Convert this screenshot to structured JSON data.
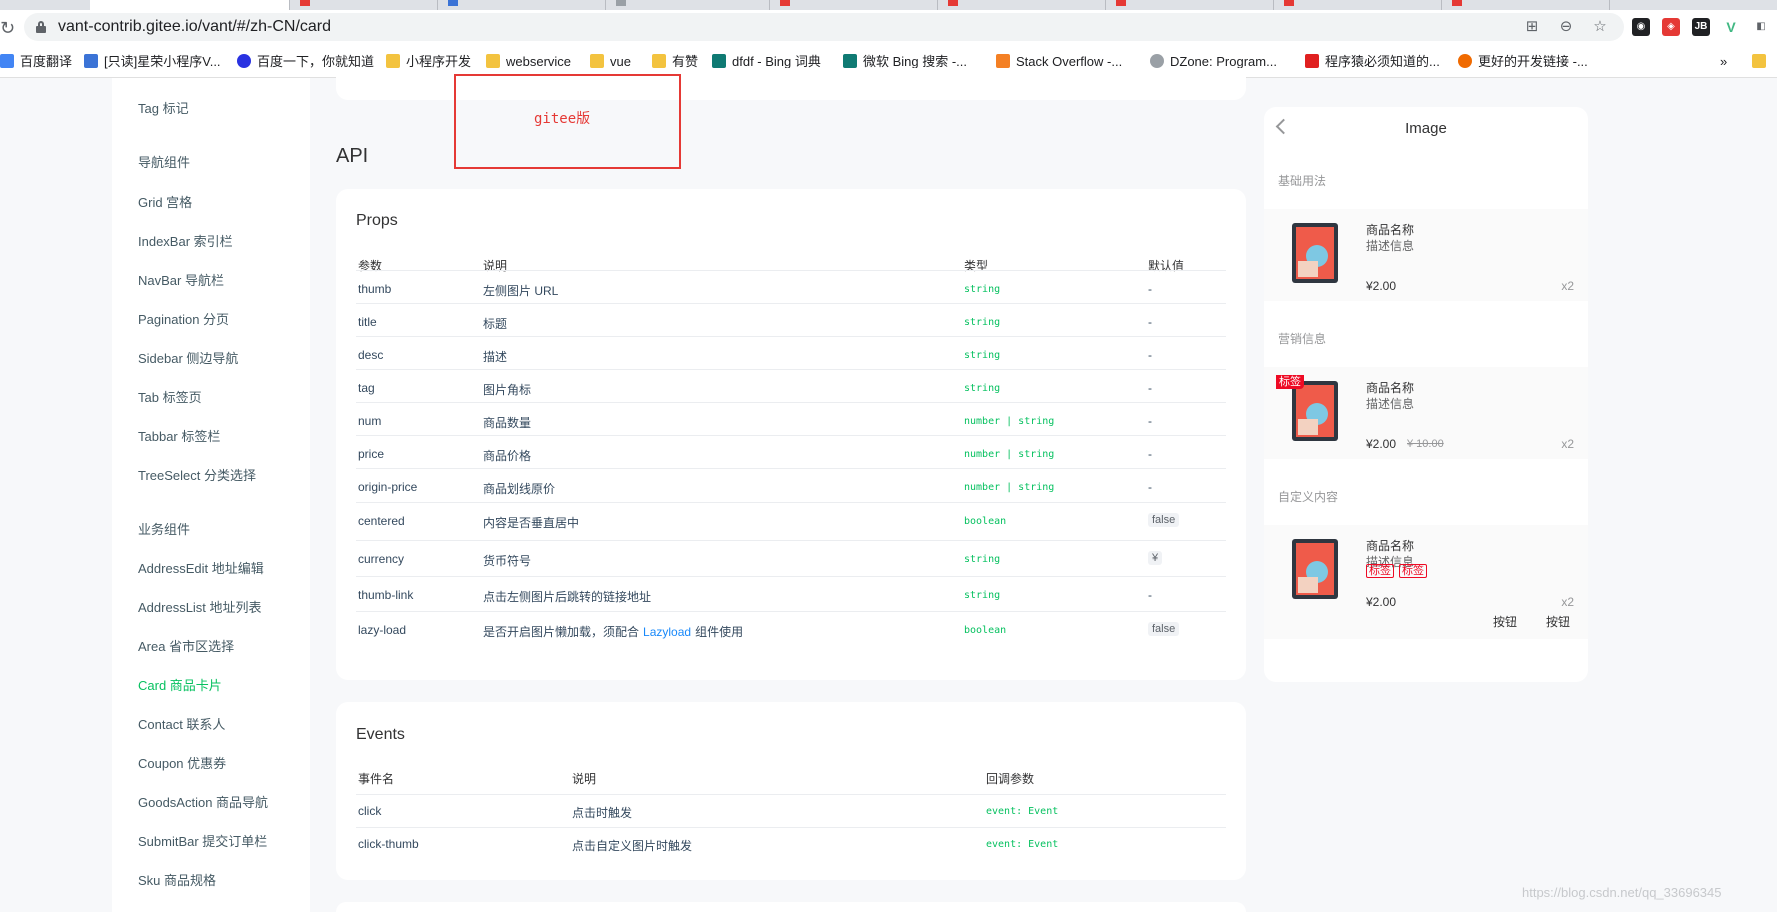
{
  "browser": {
    "url": "vant-contrib.gitee.io/vant/#/zh-CN/card"
  },
  "bookmarks": [
    {
      "label": "百度翻译",
      "icon": "translate-icon",
      "color": "#4285f4"
    },
    {
      "label": "[只读]星荣小程序V...",
      "icon": "layers-icon",
      "color": "#3b73d6"
    },
    {
      "label": "百度一下，你就知道",
      "icon": "baidu-paw-icon",
      "color": "#2932e1"
    },
    {
      "label": "小程序开发",
      "icon": "folder-icon",
      "color": "#f3c33f"
    },
    {
      "label": "webservice",
      "icon": "folder-icon",
      "color": "#f3c33f"
    },
    {
      "label": "vue",
      "icon": "folder-icon",
      "color": "#f3c33f"
    },
    {
      "label": "有赞",
      "icon": "folder-icon",
      "color": "#f3c33f"
    },
    {
      "label": "dfdf - Bing 词典",
      "icon": "bing-icon",
      "color": "#0f7a73"
    },
    {
      "label": "微软 Bing 搜索 -...",
      "icon": "bing-icon",
      "color": "#0f7a73"
    },
    {
      "label": "Stack Overflow -...",
      "icon": "stackoverflow-icon",
      "color": "#f48024"
    },
    {
      "label": "DZone: Program...",
      "icon": "dzone-icon",
      "color": "#9aa0a6"
    },
    {
      "label": "程序猿必须知道的...",
      "icon": "csdn-icon",
      "color": "#e02020"
    },
    {
      "label": "更好的开发链接 -...",
      "icon": "b-circle-icon",
      "color": "#f06a00"
    }
  ],
  "bookmarks_more": "»",
  "sidebar": {
    "items": [
      {
        "label": "Tag 标记"
      },
      {
        "label": "导航组件",
        "group": true
      },
      {
        "label": "Grid 宫格"
      },
      {
        "label": "IndexBar 索引栏"
      },
      {
        "label": "NavBar 导航栏"
      },
      {
        "label": "Pagination 分页"
      },
      {
        "label": "Sidebar 侧边导航"
      },
      {
        "label": "Tab 标签页"
      },
      {
        "label": "Tabbar 标签栏"
      },
      {
        "label": "TreeSelect 分类选择"
      },
      {
        "label": "业务组件",
        "group": true
      },
      {
        "label": "AddressEdit 地址编辑"
      },
      {
        "label": "AddressList 地址列表"
      },
      {
        "label": "Area 省市区选择"
      },
      {
        "label": "Card 商品卡片",
        "active": true
      },
      {
        "label": "Contact 联系人"
      },
      {
        "label": "Coupon 优惠券"
      },
      {
        "label": "GoodsAction 商品导航"
      },
      {
        "label": "SubmitBar 提交订单栏"
      },
      {
        "label": "Sku 商品规格"
      }
    ]
  },
  "annotation": {
    "text": "gitee版",
    "color": "#e53935"
  },
  "main": {
    "api_title": "API",
    "props": {
      "title": "Props",
      "headers": [
        "参数",
        "说明",
        "类型",
        "默认值"
      ],
      "rows": [
        {
          "param": "thumb",
          "desc": "左侧图片 URL",
          "type": "string",
          "default": "-"
        },
        {
          "param": "title",
          "desc": "标题",
          "type": "string",
          "default": "-"
        },
        {
          "param": "desc",
          "desc": "描述",
          "type": "string",
          "default": "-"
        },
        {
          "param": "tag",
          "desc": "图片角标",
          "type": "string",
          "default": "-"
        },
        {
          "param": "num",
          "desc": "商品数量",
          "type": "number | string",
          "default": "-"
        },
        {
          "param": "price",
          "desc": "商品价格",
          "type": "number | string",
          "default": "-"
        },
        {
          "param": "origin-price",
          "desc": "商品划线原价",
          "type": "number | string",
          "default": "-"
        },
        {
          "param": "centered",
          "desc": "内容是否垂直居中",
          "type": "boolean",
          "default": "false",
          "code": true
        },
        {
          "param": "currency",
          "desc": "货币符号",
          "type": "string",
          "default": "¥",
          "code": true
        },
        {
          "param": "thumb-link",
          "desc": "点击左侧图片后跳转的链接地址",
          "type": "string",
          "default": "-"
        },
        {
          "param": "lazy-load",
          "desc": "是否开启图片懒加载，须配合",
          "desc_link": "Lazyload",
          "desc_after": "组件使用",
          "type": "boolean",
          "default": "false",
          "code": true
        }
      ]
    },
    "events": {
      "title": "Events",
      "headers": [
        "事件名",
        "说明",
        "回调参数"
      ],
      "rows": [
        {
          "name": "click",
          "desc": "点击时触发",
          "args": "event: Event"
        },
        {
          "name": "click-thumb",
          "desc": "点击自定义图片时触发",
          "args": "event: Event"
        }
      ]
    }
  },
  "phone": {
    "title": "Image",
    "sections": [
      {
        "title": "基础用法",
        "name": "商品名称",
        "desc": "描述信息",
        "price": "¥2.00",
        "num": "x2"
      },
      {
        "title": "营销信息",
        "name": "商品名称",
        "desc": "描述信息",
        "price": "¥2.00",
        "origin": "¥ 10.00",
        "num": "x2",
        "tag": "标签"
      },
      {
        "title": "自定义内容",
        "name": "商品名称",
        "desc": "描述信息",
        "price": "¥2.00",
        "num": "x2",
        "tags": [
          "标签",
          "标签"
        ],
        "buttons": [
          "按钮",
          "按钮"
        ]
      }
    ]
  },
  "watermark": "https://blog.csdn.net/qq_33696345",
  "colors": {
    "accent": "#07c160",
    "link": "#1989fa",
    "danger": "#ee0a24"
  }
}
